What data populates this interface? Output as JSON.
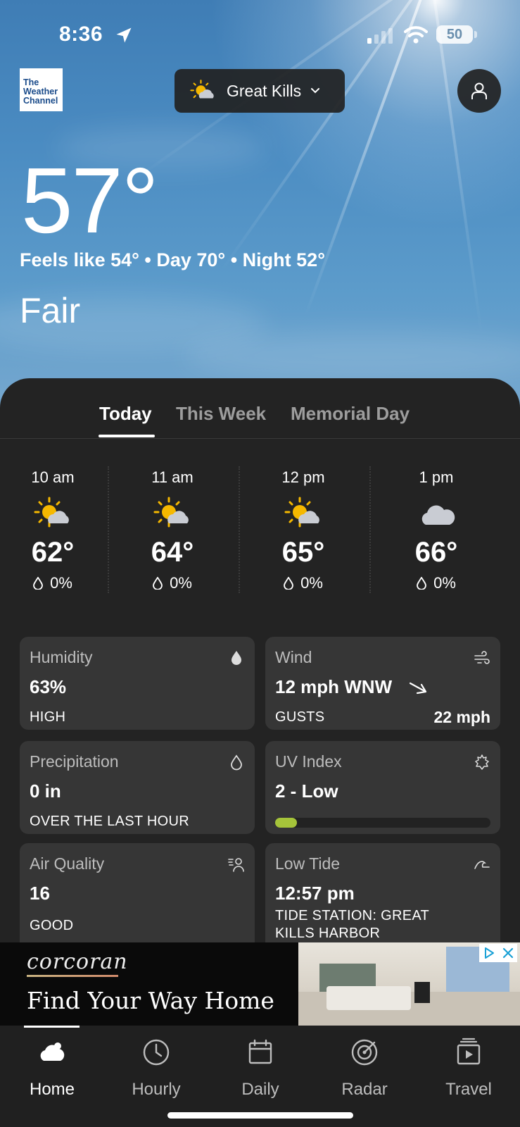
{
  "status_bar": {
    "time": "8:36",
    "battery": "50"
  },
  "header": {
    "logo_text": "The Weather Channel",
    "location": "Great Kills"
  },
  "current": {
    "temperature": "57°",
    "feels_line": "Feels like 54° • Day 70° • Night 52°",
    "condition": "Fair"
  },
  "tabs": [
    {
      "label": "Today",
      "active": true
    },
    {
      "label": "This Week",
      "active": false
    },
    {
      "label": "Memorial Day",
      "active": false
    }
  ],
  "hourly": [
    {
      "time": "10 am",
      "icon": "partly-sunny-icon",
      "temp": "62°",
      "precip": "0%"
    },
    {
      "time": "11 am",
      "icon": "partly-sunny-icon",
      "temp": "64°",
      "precip": "0%"
    },
    {
      "time": "12 pm",
      "icon": "partly-sunny-icon",
      "temp": "65°",
      "precip": "0%"
    },
    {
      "time": "1 pm",
      "icon": "cloud-icon",
      "temp": "66°",
      "precip": "0%"
    }
  ],
  "cards": {
    "humidity": {
      "title": "Humidity",
      "value": "63%",
      "sub": "HIGH"
    },
    "wind": {
      "title": "Wind",
      "value": "12 mph WNW",
      "sub": "GUSTS",
      "gusts": "22 mph"
    },
    "precipitation": {
      "title": "Precipitation",
      "value": "0 in",
      "sub": "OVER THE LAST HOUR"
    },
    "uv": {
      "title": "UV Index",
      "value": "2 - Low",
      "level_fraction": 0.1
    },
    "air_quality": {
      "title": "Air Quality",
      "value": "16",
      "sub": "GOOD"
    },
    "tide": {
      "title": "Low Tide",
      "value": "12:57 pm",
      "sub_line1": "TIDE STATION: GREAT",
      "sub_line2": "KILLS HARBOR"
    }
  },
  "ad": {
    "brand": "corcoran",
    "slogan": "Find Your Way Home"
  },
  "nav": [
    {
      "label": "Home",
      "icon": "home-cloud-icon",
      "active": true
    },
    {
      "label": "Hourly",
      "icon": "clock-icon",
      "active": false
    },
    {
      "label": "Daily",
      "icon": "calendar-icon",
      "active": false
    },
    {
      "label": "Radar",
      "icon": "radar-icon",
      "active": false
    },
    {
      "label": "Travel",
      "icon": "travel-icon",
      "active": false
    }
  ],
  "colors": {
    "sheet": "#232323",
    "card": "#363636",
    "uv_fill": "#a5c43a",
    "sun": "#f5b800"
  }
}
